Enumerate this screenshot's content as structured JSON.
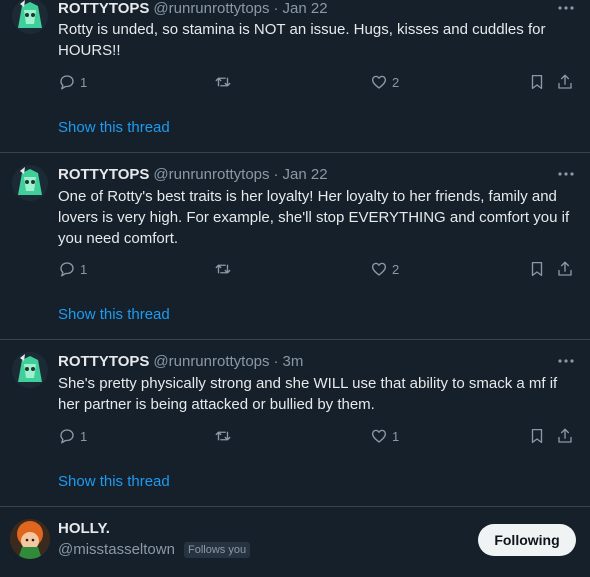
{
  "tweets": [
    {
      "name": "ROTTYTOPS",
      "handle": "@runrunrottytops",
      "time": "Jan 22",
      "text": "Rotty is unded, so stamina is NOT an issue. Hugs, kisses and cuddles for HOURS!!",
      "replies": "1",
      "likes": "2",
      "show_thread": "Show this thread"
    },
    {
      "name": "ROTTYTOPS",
      "handle": "@runrunrottytops",
      "time": "Jan 22",
      "text": "One of Rotty's best traits is her loyalty! Her loyalty to her friends, family and lovers is very high. For example, she'll stop EVERYTHING and comfort you if you need comfort.",
      "replies": "1",
      "likes": "2",
      "show_thread": "Show this thread"
    },
    {
      "name": "ROTTYTOPS",
      "handle": "@runrunrottytops",
      "time": "3m",
      "text": "She's pretty physically strong and she WILL use that ability to smack a mf if her partner is being attacked or bullied by them.",
      "replies": "1",
      "likes": "1",
      "show_thread": "Show this thread"
    }
  ],
  "dot": "·",
  "user_card": {
    "name": "HOLLY.",
    "handle": "@misstasseltown",
    "follows_you": "Follows you",
    "button": "Following"
  },
  "colors": {
    "background": "#15202b",
    "link": "#1d9bf0",
    "muted": "#8b98a5"
  },
  "icons": [
    "more-icon",
    "reply-icon",
    "retweet-icon",
    "like-icon",
    "bookmark-icon",
    "share-icon"
  ]
}
